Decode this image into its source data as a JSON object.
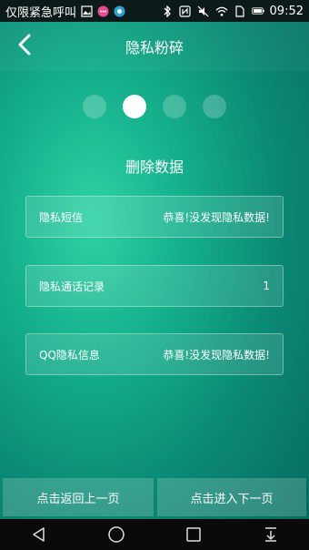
{
  "status_bar": {
    "left_text": "仅限紧急呼叫",
    "time": "09:52",
    "icons": [
      "picture-icon",
      "chat-bubble-icon",
      "circle-app-icon",
      "bluetooth-icon",
      "nfc-icon",
      "mute-icon",
      "wifi-icon",
      "sim-icon",
      "battery-icon"
    ]
  },
  "header": {
    "title": "隐私粉碎"
  },
  "steps": {
    "count": 4,
    "active_index": 1
  },
  "section_title": "删除数据",
  "cards": [
    {
      "label": "隐私短信",
      "value": "恭喜!没发现隐私数据!"
    },
    {
      "label": "隐私通话记录",
      "value": "1"
    },
    {
      "label": "QQ隐私信息",
      "value": "恭喜!没发现隐私数据!"
    }
  ],
  "buttons": {
    "prev_label": "点击返回上一页",
    "next_label": "点击进入下一页"
  },
  "nav": {
    "icons": [
      "back-triangle-icon",
      "home-circle-icon",
      "recents-square-icon",
      "notification-pull-icon"
    ]
  },
  "colors": {
    "accent": "#14b08c",
    "status_bg": "#0c1b19",
    "nav_bg": "#0a0a0a"
  }
}
